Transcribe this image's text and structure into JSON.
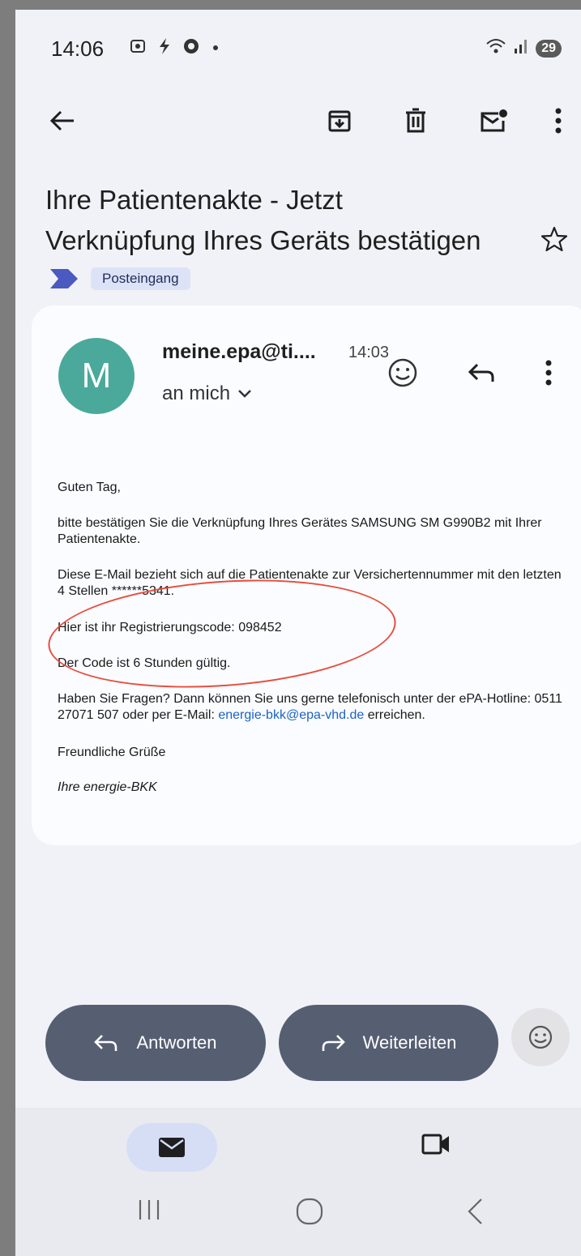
{
  "status_bar": {
    "time": "14:06",
    "battery": "29",
    "icons": [
      "screenshot-icon",
      "flash-icon",
      "chrome-icon",
      "dot-icon",
      "wifi-icon",
      "signal-icon"
    ]
  },
  "toolbar": {
    "icons": [
      "back-arrow-icon",
      "archive-icon",
      "delete-icon",
      "mark-unread-icon",
      "more-vert-icon"
    ]
  },
  "subject": {
    "line1": "Ihre Patientenakte - Jetzt",
    "line2": "Verknüpfung Ihres Geräts bestätigen",
    "label": "Posteingang"
  },
  "message": {
    "avatar_letter": "M",
    "avatar_color": "#4aa99a",
    "sender": "meine.epa@ti....",
    "time": "14:03",
    "recipient": "an mich",
    "body": {
      "greeting": "Guten Tag,",
      "p1": "bitte bestätigen Sie die Verknüpfung Ihres Gerätes SAMSUNG SM G990B2 mit Ihrer Patientenakte.",
      "p2": "Diese E-Mail bezieht sich auf die Patientenakte zur Versichertennummer mit den letzten 4 Stellen ******5341.",
      "code_line": "Hier ist ihr Registrierungscode: 098452",
      "validity": "Der Code ist 6 Stunden gültig.",
      "p3_prefix": "Haben Sie Fragen? Dann können Sie uns gerne telefonisch unter der ePA-Hotline: 0511 27071 507 oder per E-Mail: ",
      "p3_link": "energie-bkk@epa-vhd.de",
      "p3_suffix": " erreichen.",
      "closing": "Freundliche Grüße",
      "signature": "Ihre energie-BKK"
    }
  },
  "actions": {
    "reply": "Antworten",
    "forward": "Weiterleiten"
  },
  "accent_colors": {
    "action_button": "#565e72",
    "link": "#1a62c6",
    "annotation_ring": "#e84d3d"
  }
}
